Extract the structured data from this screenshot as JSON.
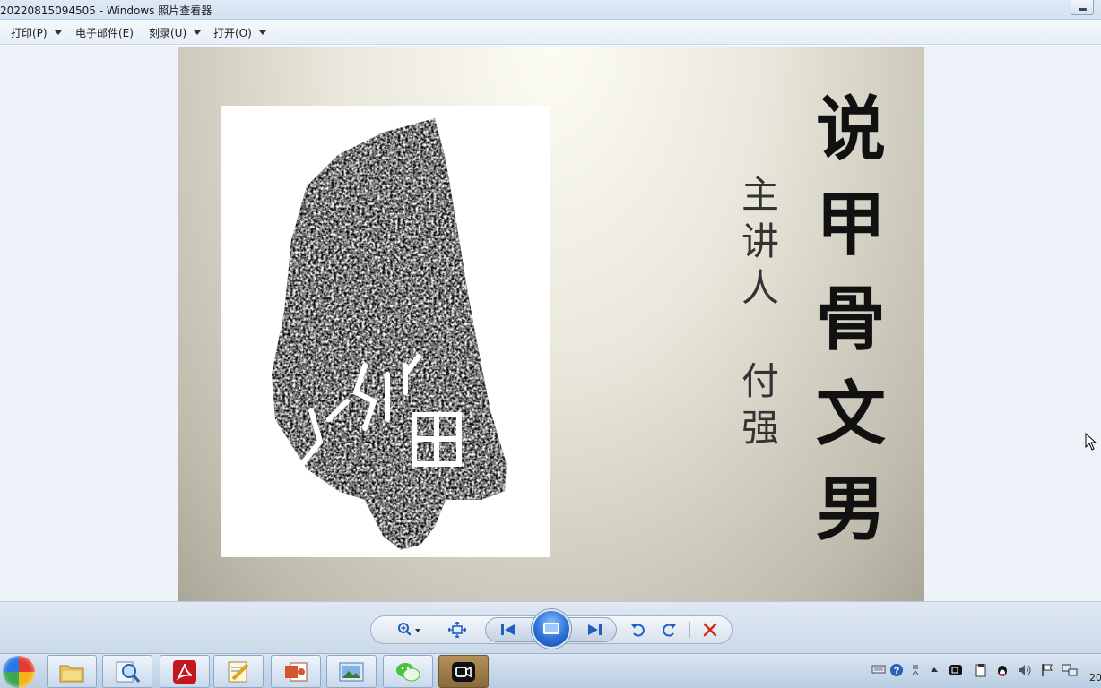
{
  "window": {
    "title": "20220815094505 - Windows 照片查看器"
  },
  "menu": {
    "print": "打印(P)",
    "email": "电子邮件(E)",
    "burn": "刻录(U)",
    "open": "打开(O)"
  },
  "slide": {
    "title_chars": [
      "说",
      "甲",
      "骨",
      "文",
      "男"
    ],
    "lecturer_label_chars": [
      "主",
      "讲",
      "人"
    ],
    "lecturer_name_chars": [
      "付",
      "强"
    ]
  },
  "controls": {
    "icons": [
      "zoom-icon",
      "fit-window-icon",
      "previous-icon",
      "slideshow-icon",
      "next-icon",
      "rotate-counterclockwise-icon",
      "rotate-clockwise-icon",
      "delete-icon"
    ]
  },
  "taskbar": {
    "apps": [
      "explorer",
      "search-tool",
      "pdf-reader",
      "notepad",
      "powerpoint",
      "photo-viewer",
      "wechat",
      "video-recorder"
    ],
    "clock_partial": "20"
  },
  "colors": {
    "delete": "#d52b1e",
    "blue_buttons": "#2b6fd6",
    "ink": "#111111"
  }
}
